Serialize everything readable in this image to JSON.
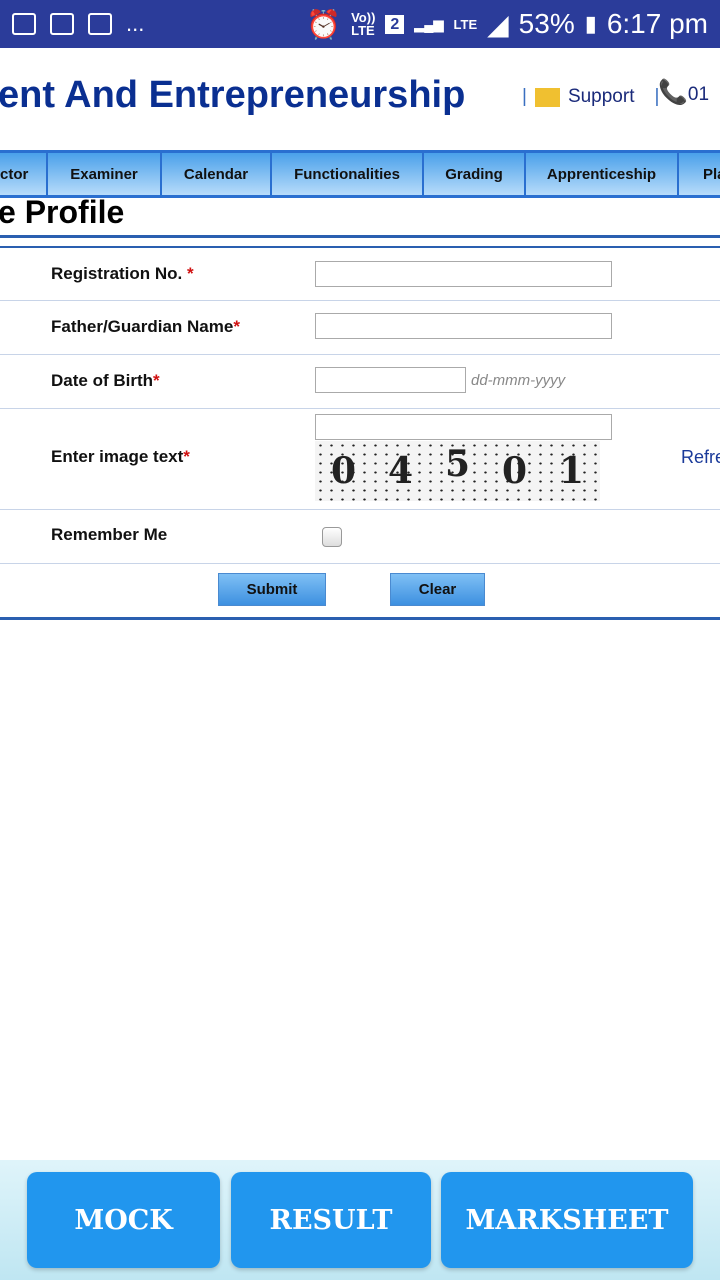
{
  "status_bar": {
    "battery": "53%",
    "time": "6:17 pm",
    "network": "LTE",
    "sim": "2",
    "more": "..."
  },
  "header": {
    "title": "ent And Entrepreneurship",
    "support": "Support",
    "phone": "01",
    "separator": "|"
  },
  "nav": {
    "items": [
      "ctor",
      "Examiner",
      "Calendar",
      "Functionalities",
      "Grading",
      "Apprenticeship",
      "Pla"
    ]
  },
  "page_title": "e Profile",
  "form": {
    "registration_label": "Registration No. ",
    "father_label": "Father/Guardian Name",
    "dob_label": "Date of Birth",
    "dob_placeholder": "dd-mmm-yyyy",
    "captcha_label": "Enter image text",
    "captcha_chars": [
      "0",
      "4",
      "5",
      "0",
      "1"
    ],
    "refresh": "Refre",
    "remember_label": "Remember Me",
    "required": "*",
    "remember_checked": false,
    "submit": "Submit",
    "clear": "Clear"
  },
  "bottom": {
    "mock": "MOCK",
    "result": "RESULT",
    "marksheet": "MARKSHEET"
  }
}
